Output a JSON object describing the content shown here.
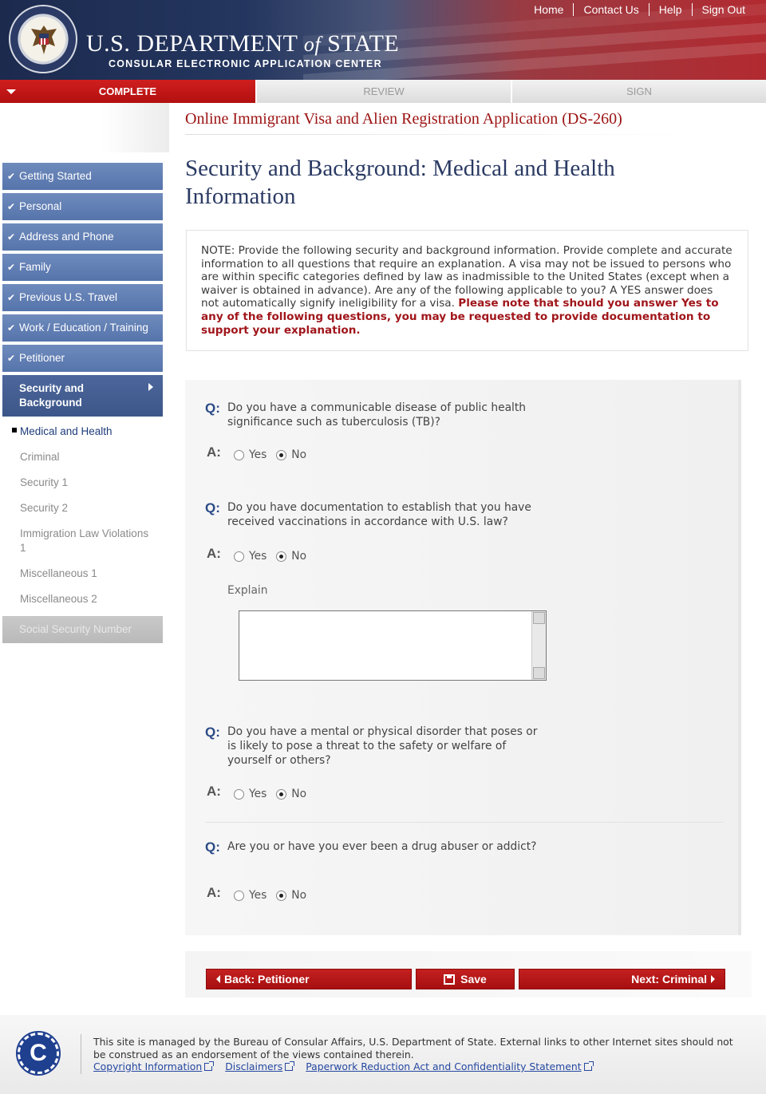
{
  "header": {
    "nav": [
      "Home",
      "Contact Us",
      "Help",
      "Sign Out"
    ],
    "dept_prefix": "U.S. DEPARTMENT ",
    "dept_of": "of",
    "dept_suffix": " STATE",
    "subtitle": "CONSULAR ELECTRONIC APPLICATION CENTER"
  },
  "progress": {
    "complete": "COMPLETE",
    "review": "REVIEW",
    "sign": "SIGN"
  },
  "sidebar": {
    "done_items": [
      "Getting Started",
      "Personal",
      "Address and Phone",
      "Family",
      "Previous U.S. Travel",
      "Work / Education / Training",
      "Petitioner"
    ],
    "current": "Security and Background",
    "subitems": [
      "Medical and Health",
      "Criminal",
      "Security 1",
      "Security 2",
      "Immigration Law Violations 1",
      "Miscellaneous 1",
      "Miscellaneous 2"
    ],
    "disabled": "Social Security Number"
  },
  "main": {
    "app_title": "Online Immigrant Visa and Alien Registration Application (DS-260)",
    "page_title": "Security and Background: Medical and Health Information",
    "note_text": "NOTE: Provide the following security and background information. Provide complete and accurate information to all questions that require an explanation. A visa may not be issued to persons who are within specific categories defined by law as inadmissible to the United States (except when a waiver is obtained in advance). Are any of the following applicable to you? A YES answer does not automatically signify ineligibility for a visa. ",
    "note_warning": "Please note that should you answer Yes to any of the following questions, you may be requested to provide documentation to support your explanation.",
    "q_label": "Q:",
    "a_label": "A:",
    "yes": "Yes",
    "no": "No",
    "explain_label": "Explain",
    "questions": [
      "Do you have a communicable disease of public health significance such as tuberculosis (TB)?",
      "Do you have documentation to establish that you have received vaccinations in accordance with U.S. law?",
      "Do you have a mental or physical disorder that poses or is likely to pose a threat to the safety or welfare of yourself or others?",
      "Are you or have you ever been a drug abuser or addict?"
    ],
    "selected": [
      "No",
      "No",
      "No",
      "No"
    ]
  },
  "buttons": {
    "back": "Back: Petitioner",
    "save": "Save",
    "next": "Next: Criminal"
  },
  "footer": {
    "text": "This site is managed by the Bureau of Consular Affairs, U.S. Department of State. External links to other Internet sites should not be construed as an endorsement of the views contained therein.",
    "links": [
      "Copyright Information",
      "Disclaimers",
      "Paperwork Reduction Act and Confidentiality Statement"
    ],
    "logo_letter": "C"
  },
  "colors": {
    "brand_red": "#b30f0f",
    "nav_blue": "#5574ab",
    "title_navy": "#2a3a63",
    "warning_red": "#a0161b"
  }
}
